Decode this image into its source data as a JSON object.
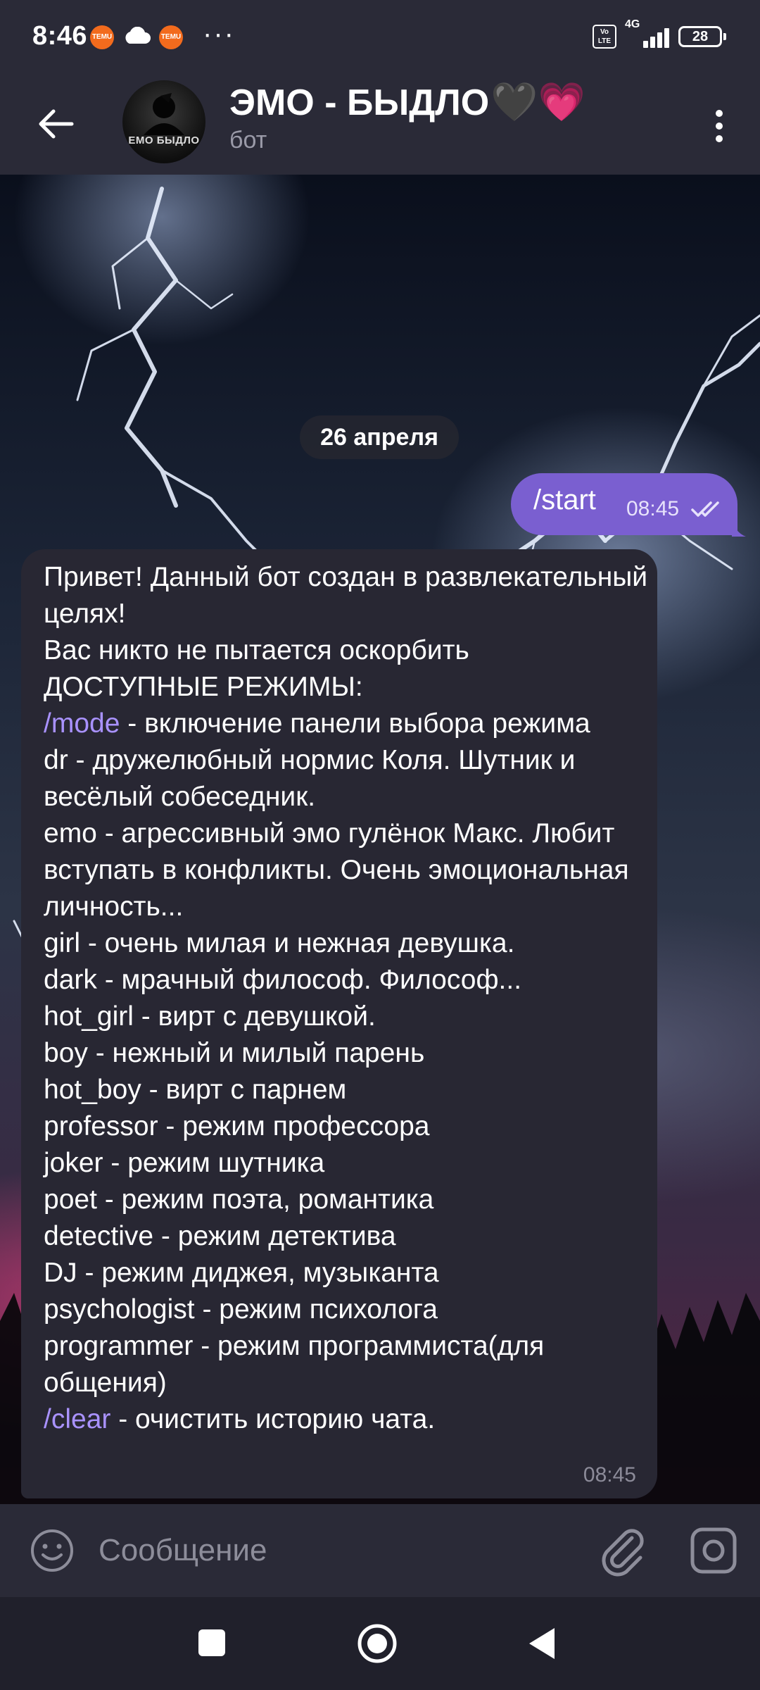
{
  "status_bar": {
    "time": "8:46",
    "app_icon_label": "TEMU",
    "overflow": "···",
    "volte": "Vo LTE",
    "network": "4G",
    "battery": "28"
  },
  "header": {
    "title": "ЭМО - БЫДЛО",
    "title_heart_black": "🖤",
    "title_heart_pink": "💗",
    "subtitle": "бот",
    "avatar_text": "EMO БЫДЛО"
  },
  "chat": {
    "date_label": "26 апреля",
    "outgoing": {
      "text": "/start",
      "time": "08:45",
      "status": "read"
    },
    "incoming": {
      "time": "08:45",
      "lines": [
        "Привет! Данный бот создан в развлекательный целях!",
        "Вас никто не пытается оскорбить",
        "ДОСТУПНЫЕ РЕЖИМЫ:"
      ],
      "mode_cmd": "/mode",
      "mode_desc": " - включение панели выбора режима",
      "modes": [
        "dr - дружелюбный нормис Коля. Шутник и весёлый собеседник.",
        "emo - агрессивный эмо гулёнок Макс. Любит вступать в конфликты. Очень эмоциональная личность...",
        "girl - очень милая и нежная девушка.",
        "dark - мрачный философ. Философ...",
        "hot_girl - вирт с девушкой.",
        "boy - нежный и милый парень",
        "hot_boy - вирт с парнем",
        "professor - режим профессора",
        "joker - режим шутника",
        "poet - режим поэта, романтика",
        "detective - режим детектива",
        "DJ - режим диджея, музыканта",
        "psychologist - режим психолога",
        "programmer - режим программиста(для общения)"
      ],
      "clear_cmd": "/clear",
      "clear_desc": " - очистить историю чата."
    }
  },
  "composer": {
    "placeholder": "Сообщение"
  },
  "icons": {
    "back": "back-arrow-icon",
    "menu": "more-vertical-icon",
    "emoji": "emoji-icon",
    "attach": "paperclip-icon",
    "camera": "camera-icon",
    "nav_recent": "square-icon",
    "nav_home": "circle-icon",
    "nav_back": "triangle-icon"
  },
  "colors": {
    "accent": "#7a5fd0",
    "link": "#a992ff",
    "bubble_in": "#282733",
    "bar": "#2a2a37"
  }
}
